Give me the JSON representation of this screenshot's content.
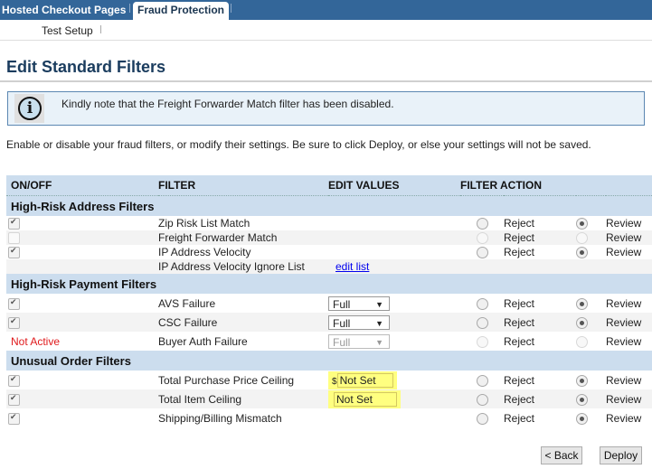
{
  "top_nav": {
    "tabs": [
      {
        "label": "Hosted Checkout Pages",
        "active": false
      },
      {
        "label": "Fraud Protection",
        "active": true
      }
    ]
  },
  "sub_nav": {
    "items": [
      {
        "label": "Test Setup"
      }
    ]
  },
  "page": {
    "title": "Edit Standard Filters",
    "notice": {
      "icon": "info-icon",
      "message": "Kindly note that the Freight Forwarder Match filter has been disabled."
    },
    "intro": "Enable or disable your fraud filters, or modify their settings. Be sure to click Deploy, or else your settings will not be saved."
  },
  "table": {
    "headers": {
      "on_off": "ON/OFF",
      "filter": "FILTER",
      "edit_values": "EDIT VALUES",
      "filter_action": "FILTER ACTION"
    },
    "action_labels": {
      "reject": "Reject",
      "review": "Review"
    },
    "groups": [
      {
        "title": "High-Risk Address Filters",
        "rows": [
          {
            "name": "Zip Risk List Match",
            "enabled": true,
            "action": "review"
          },
          {
            "name": "Freight Forwarder Match",
            "enabled": false,
            "disabled": true,
            "action": "none"
          },
          {
            "name": "IP Address Velocity",
            "enabled": true,
            "action": "review"
          },
          {
            "name": "IP Address Velocity Ignore List",
            "edit_link": "edit list"
          }
        ]
      },
      {
        "title": "High-Risk Payment Filters",
        "rows": [
          {
            "name": "AVS Failure",
            "enabled": true,
            "select_value": "Full",
            "action": "review"
          },
          {
            "name": "CSC Failure",
            "enabled": true,
            "select_value": "Full",
            "action": "review"
          },
          {
            "name": "Buyer Auth Failure",
            "status": "Not Active",
            "select_value": "Full",
            "disabled": true,
            "action": "none"
          }
        ]
      },
      {
        "title": "Unusual Order Filters",
        "rows": [
          {
            "name": "Total Purchase Price Ceiling",
            "enabled": true,
            "currency": "$",
            "input_value": "Not Set",
            "action": "review"
          },
          {
            "name": "Total Item Ceiling",
            "enabled": true,
            "input_value": "Not Set",
            "action": "review"
          },
          {
            "name": "Shipping/Billing Mismatch",
            "enabled": true,
            "action": "review"
          }
        ]
      }
    ]
  },
  "buttons": {
    "back": "< Back",
    "deploy": "Deploy"
  },
  "colors": {
    "nav_bg": "#336699",
    "header_bg": "#ccddee",
    "notice_bg": "#e9f2f9",
    "highlight": "#ffff80",
    "not_active": "#e0191b"
  }
}
